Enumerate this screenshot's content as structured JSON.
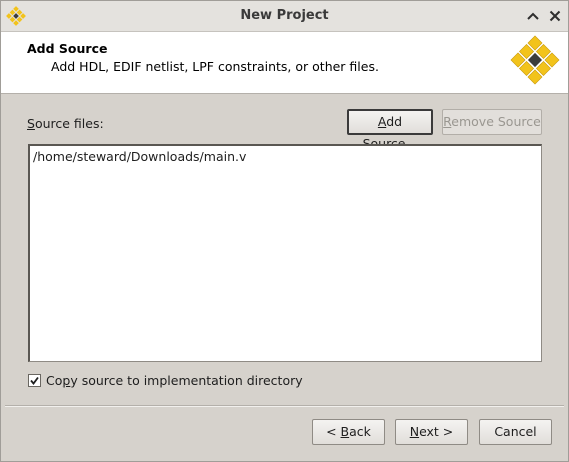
{
  "window": {
    "title": "New Project",
    "app_icon": "diamond-logo-icon",
    "controls": [
      "chevron-up-icon",
      "close-icon"
    ]
  },
  "header": {
    "title": "Add Source",
    "subtitle": "Add HDL, EDIF netlist, LPF constraints, or other files.",
    "logo": "yellow-diamond-grid-logo"
  },
  "source": {
    "label_ul": "S",
    "label_rest": "ource files:",
    "add_ul": "A",
    "add_rest": "dd Source...",
    "remove_ul": "R",
    "remove_rest": "emove Source",
    "files": [
      "/home/steward/Downloads/main.v"
    ]
  },
  "copy_option": {
    "checked": true,
    "label_pre": "Co",
    "label_ul": "p",
    "label_post": "y source to implementation directory"
  },
  "footer": {
    "back_pre": "< ",
    "back_ul": "B",
    "back_post": "ack",
    "next_ul": "N",
    "next_post": "ext >",
    "cancel": "Cancel"
  },
  "colors": {
    "logo_yellow": "#f2c31b",
    "logo_dark": "#3c3c3c",
    "window_bg": "#d6d2cc",
    "header_bg": "#ffffff"
  }
}
